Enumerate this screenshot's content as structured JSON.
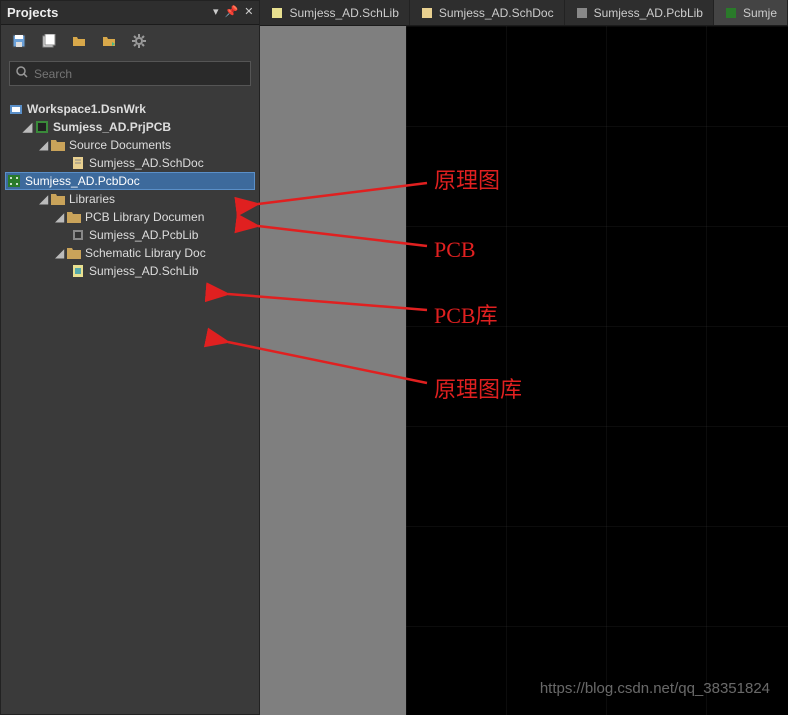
{
  "panel": {
    "title": "Projects",
    "search_placeholder": "Search"
  },
  "tree": {
    "workspace": "Workspace1.DsnWrk",
    "project": "Sumjess_AD.PrjPCB",
    "source_docs_label": "Source Documents",
    "schdoc": "Sumjess_AD.SchDoc",
    "pcbdoc": "Sumjess_AD.PcbDoc",
    "libraries_label": "Libraries",
    "pcb_lib_folder": "PCB Library Documen",
    "pcblib": "Sumjess_AD.PcbLib",
    "sch_lib_folder": "Schematic Library Doc",
    "schlib": "Sumjess_AD.SchLib"
  },
  "tabs": [
    {
      "label": "Sumjess_AD.SchLib",
      "icon": "schlib"
    },
    {
      "label": "Sumjess_AD.SchDoc",
      "icon": "schdoc"
    },
    {
      "label": "Sumjess_AD.PcbLib",
      "icon": "pcblib"
    },
    {
      "label": "Sumje",
      "icon": "pcbdoc",
      "active": true
    }
  ],
  "annotations": {
    "schematic": "原理图",
    "pcb": "PCB",
    "pcb_lib": "PCB库",
    "schematic_lib": "原理图库"
  },
  "watermark": "https://blog.csdn.net/qq_38351824"
}
